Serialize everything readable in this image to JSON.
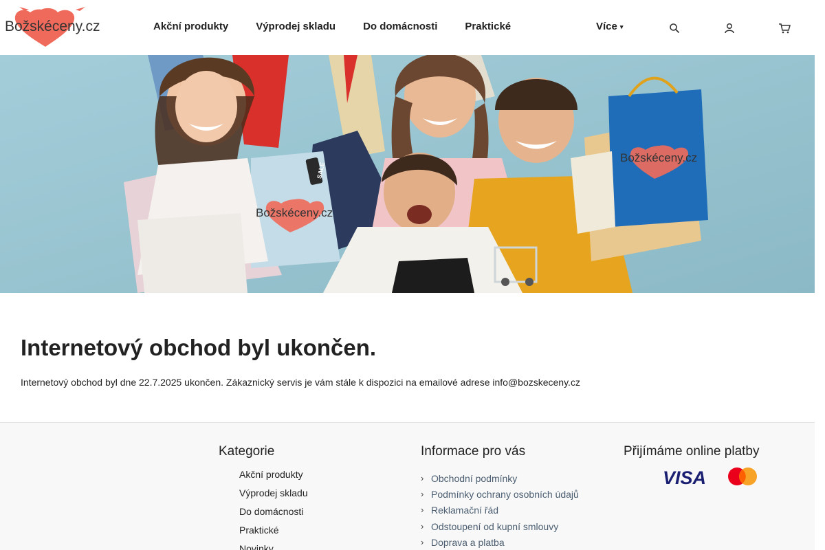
{
  "header": {
    "logo_text": "Božskéceny.cz",
    "nav": [
      "Akční produkty",
      "Výprodej skladu",
      "Do domácnosti",
      "Praktické"
    ],
    "more_label": "Více",
    "icons": [
      "search-icon",
      "user-icon",
      "cart-icon"
    ]
  },
  "hero": {
    "watermark_text": "Božskéceny.cz",
    "tag_text": "SALE"
  },
  "content": {
    "title": "Internetový obchod byl ukončen.",
    "text": "Internetový obchod byl dne 22.7.2025 ukončen. Zákaznický servis je vám stále k dispozici na emailové adrese info@bozskeceny.cz"
  },
  "footer": {
    "categories_title": "Kategorie",
    "categories": [
      "Akční produkty",
      "Výprodej skladu",
      "Do domácnosti",
      "Praktické",
      "Novinky"
    ],
    "info_title": "Informace pro vás",
    "info_links": [
      "Obchodní podmínky",
      "Podmínky ochrany osobních údajů",
      "Reklamační řád",
      "Odstoupení od kupní smlouvy",
      "Doprava a platba"
    ],
    "payments_title": "Přijímáme online platby",
    "payment_methods": [
      "VISA",
      "Mastercard"
    ]
  },
  "colors": {
    "brand_heart": "#ef6a5a",
    "hero_bg": "#93c0cd",
    "visa_blue": "#1a1f71",
    "mc_red": "#eb001b",
    "mc_orange": "#f79e1b"
  }
}
